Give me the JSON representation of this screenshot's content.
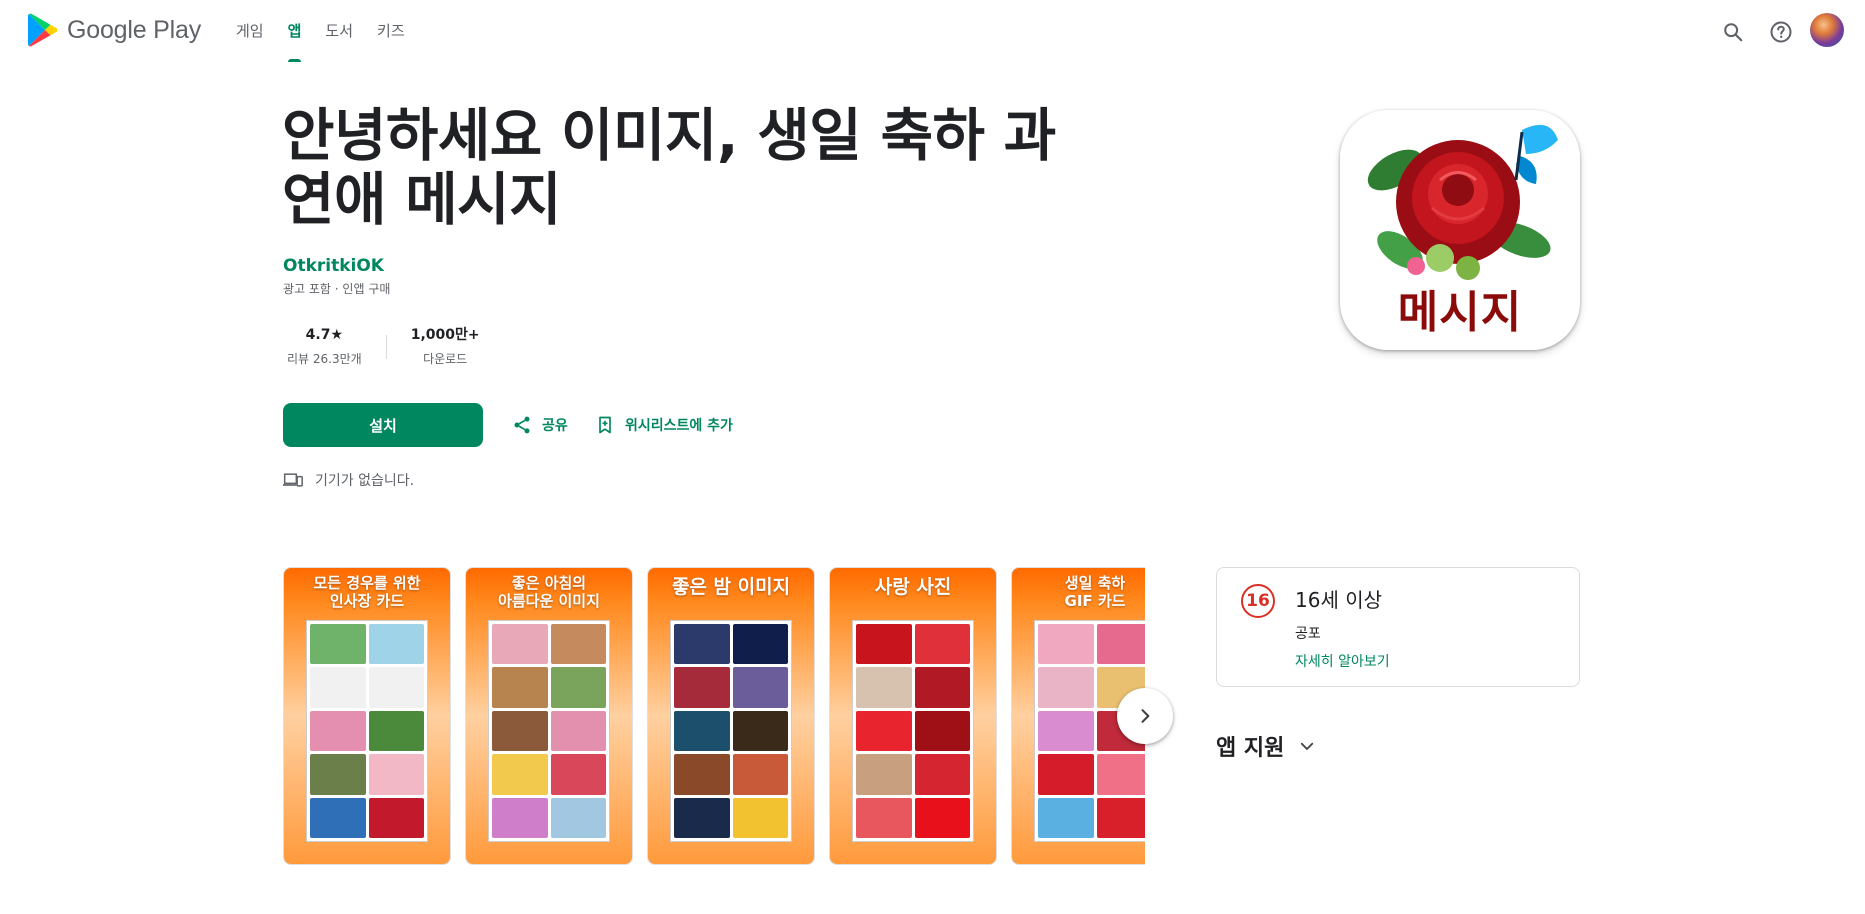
{
  "header": {
    "brand": "Google Play",
    "tabs": [
      {
        "label": "게임",
        "active": false
      },
      {
        "label": "앱",
        "active": true
      },
      {
        "label": "도서",
        "active": false
      },
      {
        "label": "키즈",
        "active": false
      }
    ],
    "icons": [
      "search-icon",
      "help-icon",
      "account-avatar"
    ]
  },
  "app": {
    "title_line1": "안녕하세요 이미지, 생일 축하 과",
    "title_line2": "연애 메시지",
    "developer": "OtkritkiOK",
    "subtitle": "광고 포함 · 인앱 구매",
    "icon_text": "메시지",
    "stats": {
      "rating": "4.7★",
      "rating_label": "리뷰 26.3만개",
      "downloads": "1,000만+",
      "downloads_label": "다운로드"
    },
    "install_label": "설치",
    "share_label": "공유",
    "wishlist_label": "위시리스트에 추가",
    "device_note": "기기가 없습니다."
  },
  "screenshots": [
    {
      "caption1": "모든 경우를 위한",
      "caption2": "인사장 카드"
    },
    {
      "caption1": "좋은 아침의",
      "caption2": "아름다운 이미지"
    },
    {
      "caption1": "좋은 밤 이미지",
      "caption2": ""
    },
    {
      "caption1": "사랑 사진",
      "caption2": ""
    },
    {
      "caption1": "생일 축하",
      "caption2": "GIF 카드"
    }
  ],
  "content_rating": {
    "badge": "16",
    "title": "16세 이상",
    "descriptor": "공포",
    "link": "자세히 알아보기"
  },
  "app_support": {
    "label": "앱 지원"
  },
  "colors": {
    "accent": "#01875f",
    "rating_badge": "#d93025",
    "text_primary": "#202124",
    "text_secondary": "#5f6368"
  }
}
